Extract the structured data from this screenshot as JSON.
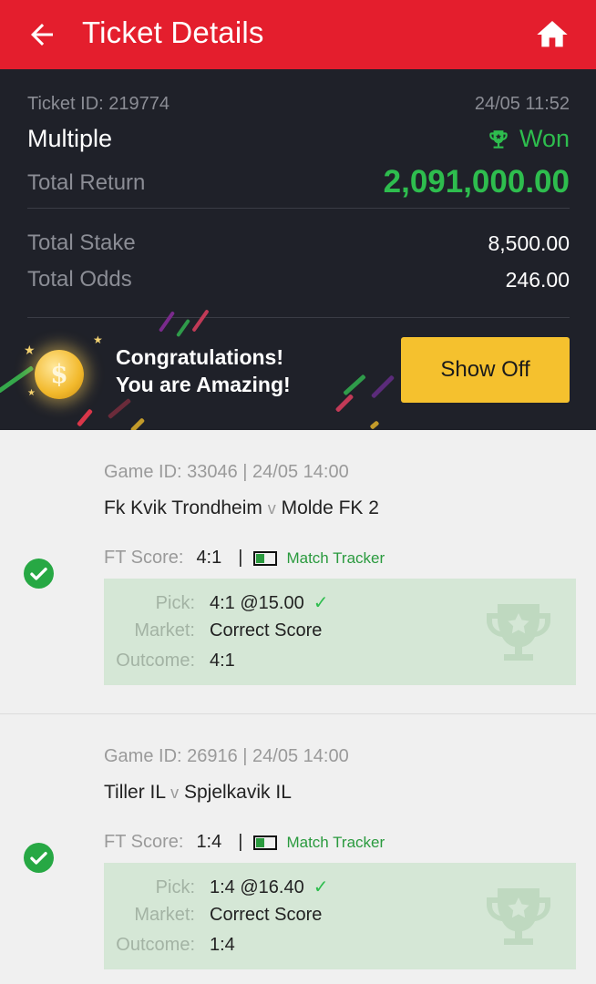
{
  "header": {
    "title": "Ticket Details"
  },
  "summary": {
    "ticket_id": "Ticket ID: 219774",
    "date": "24/05 11:52",
    "bet_type": "Multiple",
    "status": "Won",
    "total_return_label": "Total Return",
    "total_return": "2,091,000.00",
    "total_stake_label": "Total Stake",
    "total_stake": "8,500.00",
    "total_odds_label": "Total Odds",
    "total_odds": "246.00",
    "congrats_line1": "Congratulations!",
    "congrats_line2": "You are Amazing!",
    "show_off_label": "Show Off"
  },
  "games": [
    {
      "meta": "Game ID: 33046 | 24/05 14:00",
      "home": "Fk Kvik Trondheim",
      "vs": "v",
      "away": "Molde FK 2",
      "ft_label": "FT Score:",
      "ft_score": "4:1",
      "separator": "|",
      "tracker_label": "Match Tracker",
      "pick_label": "Pick:",
      "pick": "4:1 @15.00",
      "market_label": "Market:",
      "market": "Correct Score",
      "outcome_label": "Outcome:",
      "outcome": "4:1",
      "tick": "✓"
    },
    {
      "meta": "Game ID: 26916 | 24/05 14:00",
      "home": "Tiller IL",
      "vs": "v",
      "away": "Spjelkavik IL",
      "ft_label": "FT Score:",
      "ft_score": "1:4",
      "separator": "|",
      "tracker_label": "Match Tracker",
      "pick_label": "Pick:",
      "pick": "1:4 @16.40",
      "market_label": "Market:",
      "market": "Correct Score",
      "outcome_label": "Outcome:",
      "outcome": "1:4",
      "tick": "✓"
    }
  ],
  "icons": {
    "back": "arrow-left-icon",
    "home": "home-icon",
    "status": "trophy-icon",
    "coin": "coin-icon",
    "check": "check-circle-icon",
    "tracker": "match-tracker-icon",
    "watermark": "trophy-watermark-icon"
  },
  "colors": {
    "header": "#e41e2d",
    "summary_bg": "#1f2129",
    "won_green": "#2ebd4e",
    "show_off_yellow": "#f5c12e",
    "pick_box": "#d5e7d6"
  },
  "coin_symbol": "$"
}
